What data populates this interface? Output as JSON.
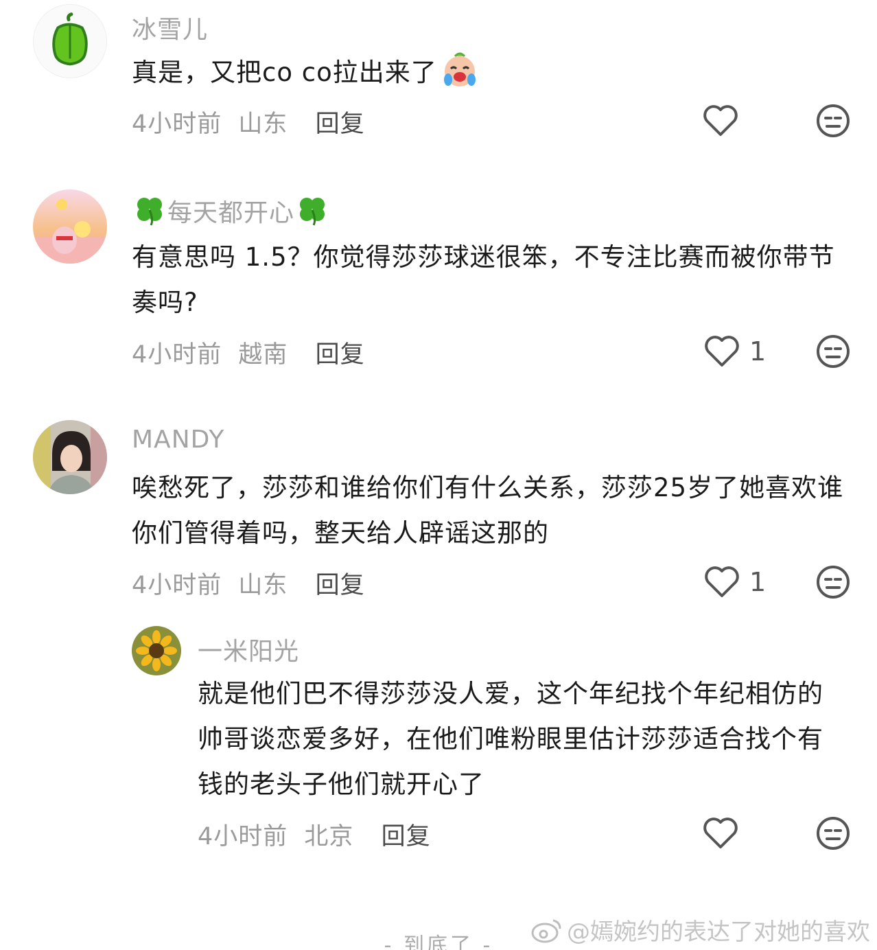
{
  "comments": [
    {
      "username": "冰雪儿",
      "text": "真是，又把co co拉出来了",
      "time": "4小时前",
      "location": "山东",
      "reply_label": "回复",
      "likes": ""
    },
    {
      "username": "每天都开心",
      "text": "有意思吗 1.5？你觉得莎莎球迷很笨，不专注比赛而被你带节奏吗?",
      "time": "4小时前",
      "location": "越南",
      "reply_label": "回复",
      "likes": "1"
    },
    {
      "username": "MANDY",
      "text": "唉愁死了，莎莎和谁给你们有什么关系，莎莎25岁了她喜欢谁你们管得着吗，整天给人辟谣这那的",
      "time": "4小时前",
      "location": "山东",
      "reply_label": "回复",
      "likes": "1"
    },
    {
      "username": "一米阳光",
      "text": "就是他们巴不得莎莎没人爱，这个年纪找个年纪相仿的帅哥谈恋爱多好，在他们唯粉眼里估计莎莎适合找个有钱的老头子他们就开心了",
      "time": "4小时前",
      "location": "北京",
      "reply_label": "回复",
      "likes": ""
    }
  ],
  "footer": {
    "end_text": "- 到底了 -",
    "watermark": "@嫣婉约的表达了对她的喜欢"
  },
  "icons": {
    "like": "heart-outline-icon",
    "dislike": "meh-face-icon",
    "emoji": "crying-laugh-emoji",
    "clover": "four-leaf-clover-icon"
  },
  "colors": {
    "username": "#a3a3a3",
    "text": "#1a1a1a",
    "meta": "#9a9a9a"
  }
}
